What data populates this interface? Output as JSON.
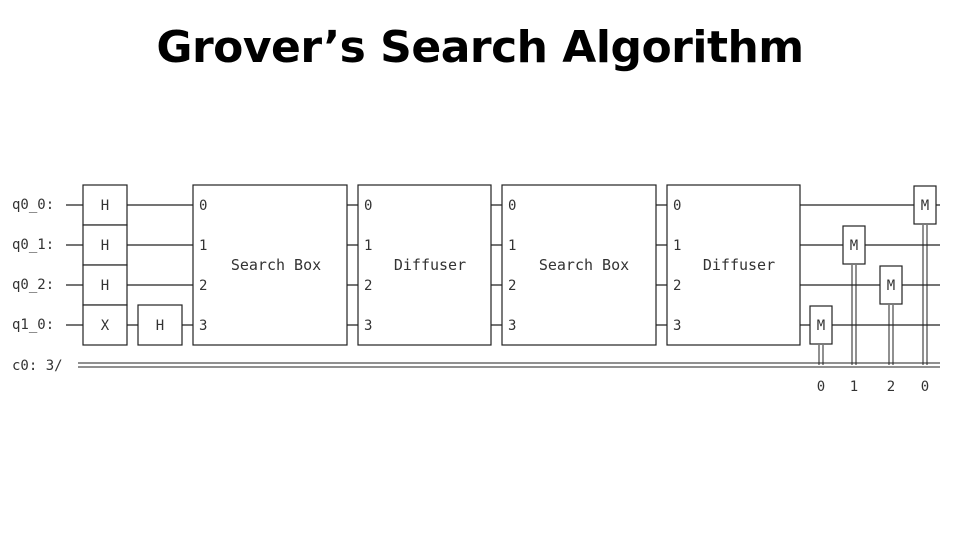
{
  "title": "Grover’s Search Algorithm",
  "circuit": {
    "qubit_labels": [
      "q0_0:",
      "q0_1:",
      "q0_2:",
      "q1_0:"
    ],
    "classical_label": "c0: 3/",
    "initial_gates": [
      "H",
      "H",
      "H",
      "X"
    ],
    "second_gate": "H",
    "blocks": [
      {
        "label": "Search Box",
        "ports": [
          "0",
          "1",
          "2",
          "3"
        ]
      },
      {
        "label": "Diffuser",
        "ports": [
          "0",
          "1",
          "2",
          "3"
        ]
      },
      {
        "label": "Search Box",
        "ports": [
          "0",
          "1",
          "2",
          "3"
        ]
      },
      {
        "label": "Diffuser",
        "ports": [
          "0",
          "1",
          "2",
          "3"
        ]
      }
    ],
    "measure_symbol": "M",
    "measurements": [
      {
        "qubit": "q1_0",
        "bit": "0"
      },
      {
        "qubit": "q0_1",
        "bit": "1"
      },
      {
        "qubit": "q0_2",
        "bit": "2"
      },
      {
        "qubit": "q0_0",
        "bit": "0"
      }
    ]
  }
}
